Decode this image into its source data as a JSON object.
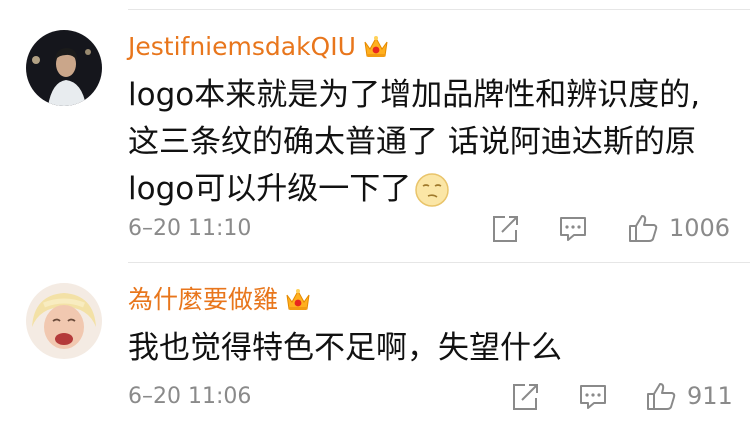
{
  "comments": [
    {
      "username": "JestifniemsdakQIU",
      "lines": [
        "logo本来就是为了增加品牌性和辨识度的,",
        "这三条纹的确太普通了 话说阿迪达斯的原",
        "logo可以升级一下了"
      ],
      "time": "6–20 11:10",
      "likes": "1006",
      "avatar_icon": "avatar-man-dark",
      "badge_icon": "crown-icon",
      "trailing_emoji": "smirk-emoji"
    },
    {
      "username": "為什麼要做雞",
      "lines": [
        "我也觉得特色不足啊，失望什么"
      ],
      "time": "6–20 11:06",
      "likes": "911",
      "avatar_icon": "avatar-laughing-blond",
      "badge_icon": "crown-icon"
    }
  ],
  "colors": {
    "username": "#e8761c",
    "meta": "#8a8a8a",
    "text": "#111111",
    "divider": "#e6e6e6"
  }
}
